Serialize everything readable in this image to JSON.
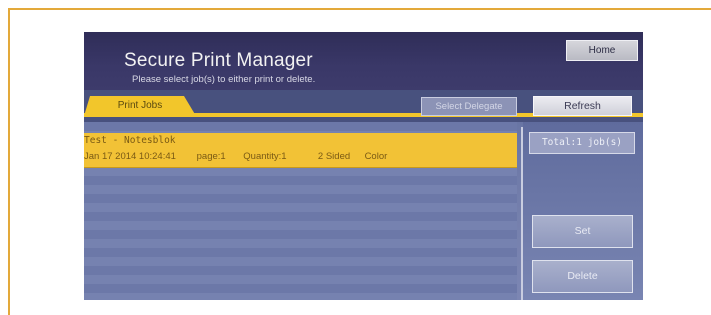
{
  "header": {
    "title": "Secure Print Manager",
    "subtitle": "Please select job(s) to either print or delete.",
    "home_label": "Home"
  },
  "tabs": {
    "print_jobs_label": "Print Jobs",
    "select_delegate_label": "Select Delegate",
    "refresh_label": "Refresh"
  },
  "jobs": [
    {
      "name": "Test - Notesblok",
      "datetime": "Jan 17 2014 10:24:41",
      "page": "page:1",
      "quantity": "Quantity:1",
      "sided": "2 Sided",
      "color": "Color"
    }
  ],
  "side_panel": {
    "total": "Total:1 job(s)",
    "set_label": "Set",
    "delete_label": "Delete"
  },
  "colors": {
    "accent": "#f2c236",
    "frame": "#e3a93a",
    "title_bar": "#2f2d58"
  }
}
